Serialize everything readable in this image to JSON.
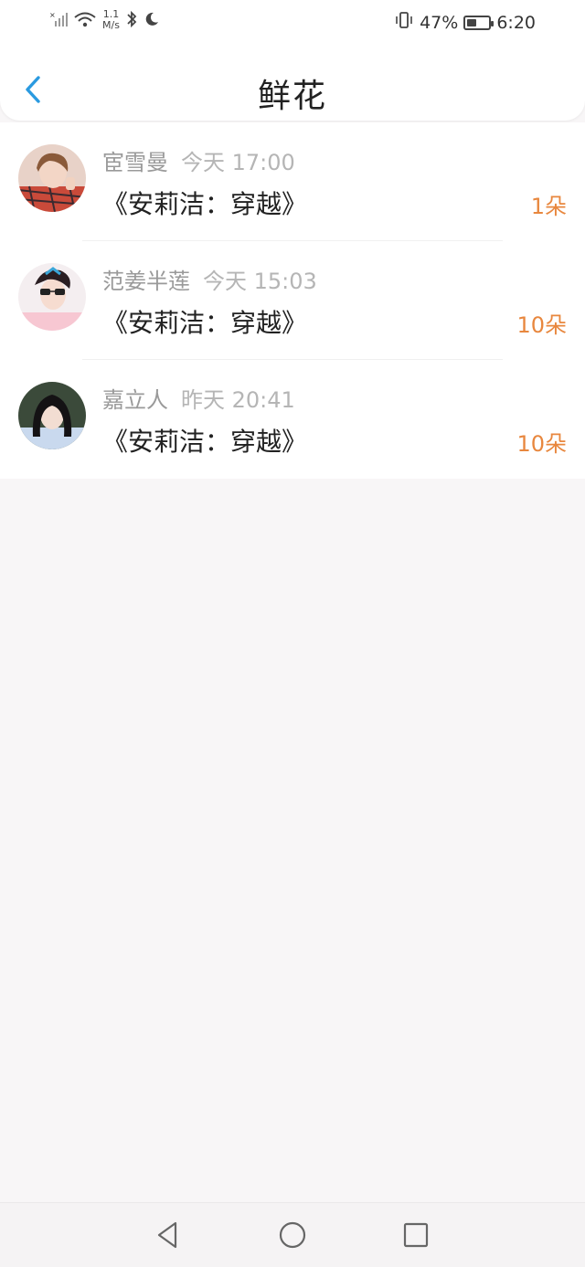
{
  "status_bar": {
    "network_speed_value": "1.1",
    "network_speed_unit": "M/s",
    "battery_percent": "47%",
    "battery_level": 0.47,
    "time": "6:20"
  },
  "header": {
    "title": "鲜花"
  },
  "gifts": [
    {
      "user": "宦雪曼",
      "time": "今天 17:00",
      "book": "《安莉洁：穿越》",
      "amount": "1朵"
    },
    {
      "user": "范姜半莲",
      "time": "今天 15:03",
      "book": "《安莉洁：穿越》",
      "amount": "10朵"
    },
    {
      "user": "嘉立人",
      "time": "昨天 20:41",
      "book": "《安莉洁：穿越》",
      "amount": "10朵"
    }
  ],
  "colors": {
    "accent_back": "#2a9ae0",
    "amount": "#e8873e"
  }
}
